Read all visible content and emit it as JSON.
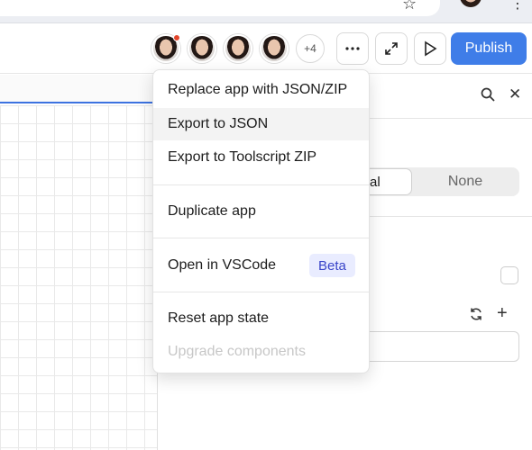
{
  "header": {
    "extra_collaborators": "+4",
    "publish_label": "Publish",
    "more_icon": "more-horizontal-icon",
    "fullscreen_icon": "expand-icon",
    "preview_icon": "play-icon"
  },
  "menu": {
    "items": [
      {
        "label": "Replace app with JSON/ZIP"
      },
      {
        "label": "Export to JSON"
      },
      {
        "label": "Export to Toolscript ZIP"
      },
      {
        "label": "Duplicate app"
      },
      {
        "label": "Open in VSCode",
        "badge": "Beta"
      },
      {
        "label": "Reset app state"
      },
      {
        "label": "Upgrade components",
        "disabled": true
      }
    ]
  },
  "panel": {
    "segmented_active": "al",
    "segmented_other": "None"
  },
  "colors": {
    "accent": "#3f7de8",
    "badge_bg": "#e9ecff",
    "badge_text": "#3a45c9",
    "presence_dot": "#e2452b"
  }
}
